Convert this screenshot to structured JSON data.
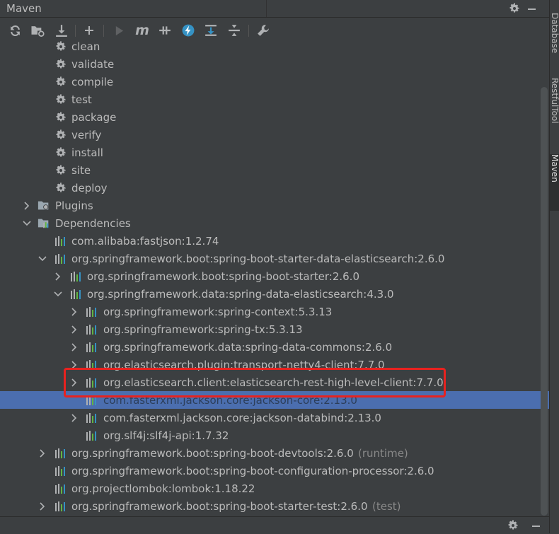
{
  "panel": {
    "title": "Maven"
  },
  "toolbar": {
    "items": [
      {
        "name": "reload-all-icon",
        "tip": "Reload All Maven Projects"
      },
      {
        "name": "generate-sources-icon",
        "tip": "Generate Sources"
      },
      {
        "name": "download-icon",
        "tip": "Download Sources"
      },
      {
        "name": "add-icon",
        "tip": "Add Maven Projects"
      },
      {
        "name": "run-icon",
        "tip": "Run Maven Build",
        "disabled": true
      },
      {
        "name": "execute-goal-icon",
        "tip": "Execute Maven Goal",
        "glyph": "m"
      },
      {
        "name": "toggle-offline-icon",
        "tip": "Toggle Offline Mode"
      },
      {
        "name": "skip-tests-icon",
        "tip": "Toggle Skip Tests Mode"
      },
      {
        "name": "show-dependencies-icon",
        "tip": "Show Dependencies"
      },
      {
        "name": "collapse-all-icon",
        "tip": "Collapse All"
      },
      {
        "name": "settings-wrench-icon",
        "tip": "Maven Settings"
      }
    ]
  },
  "tree": {
    "rows": [
      {
        "label": "clean",
        "kind": "goal",
        "depth": 3
      },
      {
        "label": "validate",
        "kind": "goal",
        "depth": 3
      },
      {
        "label": "compile",
        "kind": "goal",
        "depth": 3
      },
      {
        "label": "test",
        "kind": "goal",
        "depth": 3
      },
      {
        "label": "package",
        "kind": "goal",
        "depth": 3
      },
      {
        "label": "verify",
        "kind": "goal",
        "depth": 3
      },
      {
        "label": "install",
        "kind": "goal",
        "depth": 3
      },
      {
        "label": "site",
        "kind": "goal",
        "depth": 3
      },
      {
        "label": "deploy",
        "kind": "goal",
        "depth": 3
      },
      {
        "label": "Plugins",
        "kind": "folder",
        "depth": 1,
        "arrow": "right"
      },
      {
        "label": "Dependencies",
        "kind": "folder",
        "depth": 1,
        "arrow": "down"
      },
      {
        "label": "com.alibaba:fastjson:1.2.74",
        "kind": "dep",
        "depth": 3
      },
      {
        "label": "org.springframework.boot:spring-boot-starter-data-elasticsearch:2.6.0",
        "kind": "dep",
        "depth": 3,
        "arrow": "down"
      },
      {
        "label": "org.springframework.boot:spring-boot-starter:2.6.0",
        "kind": "dep",
        "depth": 4,
        "arrow": "right"
      },
      {
        "label": "org.springframework.data:spring-data-elasticsearch:4.3.0",
        "kind": "dep",
        "depth": 4,
        "arrow": "down"
      },
      {
        "label": "org.springframework:spring-context:5.3.13",
        "kind": "dep",
        "depth": 5,
        "arrow": "right"
      },
      {
        "label": "org.springframework:spring-tx:5.3.13",
        "kind": "dep",
        "depth": 5,
        "arrow": "right"
      },
      {
        "label": "org.springframework.data:spring-data-commons:2.6.0",
        "kind": "dep",
        "depth": 5,
        "arrow": "right"
      },
      {
        "label": "org.elasticsearch.plugin:transport-netty4-client:7.7.0",
        "kind": "dep",
        "depth": 5,
        "arrow": "right"
      },
      {
        "label": "org.elasticsearch.client:elasticsearch-rest-high-level-client:7.7.0",
        "kind": "dep",
        "depth": 5,
        "arrow": "right"
      },
      {
        "label": "com.fasterxml.jackson.core:jackson-core:2.13.0",
        "kind": "dep",
        "depth": 5,
        "selected": true
      },
      {
        "label": "com.fasterxml.jackson.core:jackson-databind:2.13.0",
        "kind": "dep",
        "depth": 5,
        "arrow": "right"
      },
      {
        "label": "org.slf4j:slf4j-api:1.7.32",
        "kind": "dep",
        "depth": 5
      },
      {
        "label": "org.springframework.boot:spring-boot-devtools:2.6.0",
        "kind": "dep",
        "depth": 3,
        "arrow": "right",
        "scope": "(runtime)"
      },
      {
        "label": "org.springframework.boot:spring-boot-configuration-processor:2.6.0",
        "kind": "dep",
        "depth": 3
      },
      {
        "label": "org.projectlombok:lombok:1.18.22",
        "kind": "dep",
        "depth": 3
      },
      {
        "label": "org.springframework.boot:spring-boot-starter-test:2.6.0",
        "kind": "dep",
        "depth": 3,
        "arrow": "right",
        "scope": "(test)"
      }
    ]
  },
  "side_tabs": [
    {
      "label": "Database"
    },
    {
      "label": "RestfulTool"
    },
    {
      "label": "Maven",
      "active": true
    }
  ],
  "colors": {
    "highlight_box": "#e8221f",
    "selection": "#4b6eaf",
    "background": "#3c3f41"
  }
}
